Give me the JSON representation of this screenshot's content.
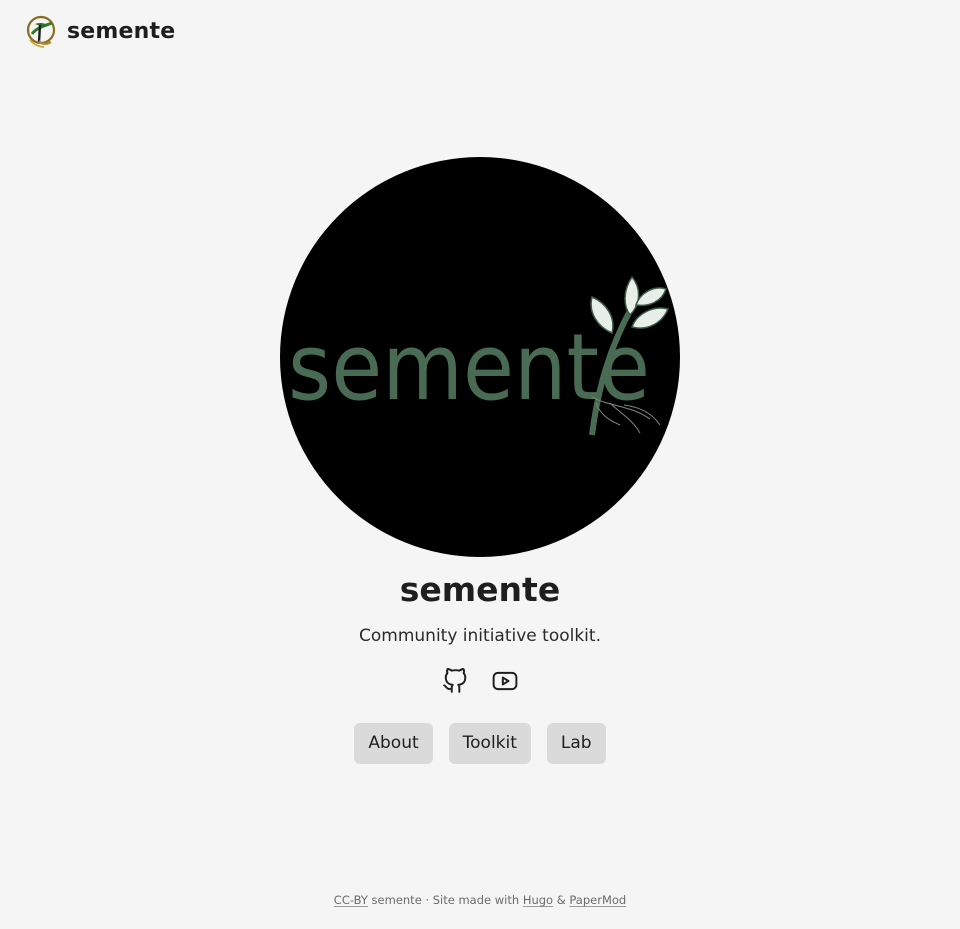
{
  "header": {
    "logo_icon": "semente-seedling-logo-icon",
    "site_title": "semente"
  },
  "profile": {
    "avatar_text": "semente",
    "title": "semente",
    "subtitle": "Community initiative toolkit.",
    "colors": {
      "avatar_bg": "#000000",
      "avatar_text": "#4a6b53"
    }
  },
  "social": [
    {
      "icon": "github-icon",
      "label": "GitHub"
    },
    {
      "icon": "youtube-icon",
      "label": "YouTube"
    }
  ],
  "buttons": [
    {
      "label": "About"
    },
    {
      "label": "Toolkit"
    },
    {
      "label": "Lab"
    }
  ],
  "footer": {
    "license_link": "CC-BY",
    "owner": "semente",
    "separator": "·",
    "made_with": "Site made with",
    "hugo_link": "Hugo",
    "amp": "&",
    "papermod_link": "PaperMod"
  }
}
